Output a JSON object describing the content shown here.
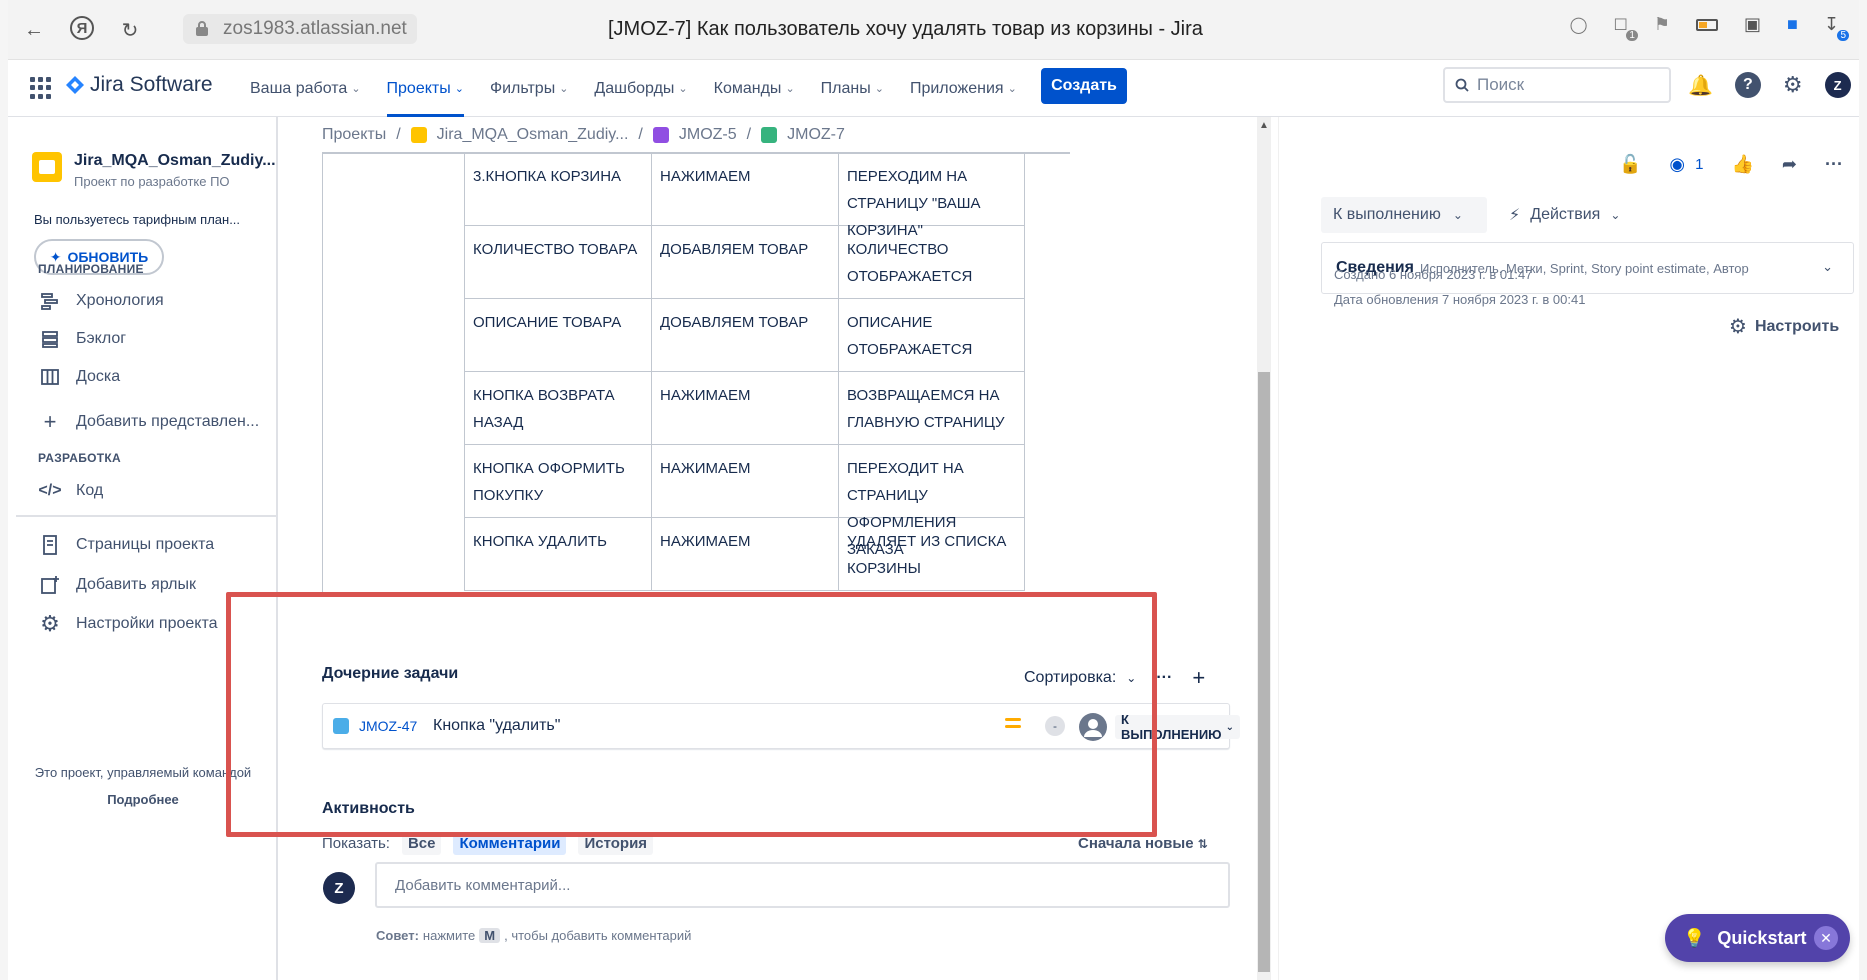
{
  "browser": {
    "url": "zos1983.atlassian.net",
    "title": "[JMOZ-7] Как пользователь хочу удалять товар из корзины - Jira",
    "badges": [
      "1",
      "5"
    ]
  },
  "topnav": {
    "product": "Jira Software",
    "items": [
      {
        "label": "Ваша работа"
      },
      {
        "label": "Проекты"
      },
      {
        "label": "Фильтры"
      },
      {
        "label": "Дашборды"
      },
      {
        "label": "Команды"
      },
      {
        "label": "Планы"
      },
      {
        "label": "Приложения"
      }
    ],
    "create_label": "Создать",
    "search_placeholder": "Поиск",
    "user_initial": "Z"
  },
  "sidebar": {
    "project_name": "Jira_MQA_Osman_Zudiy...",
    "project_type": "Проект по разработке ПО",
    "plan_note": "Вы пользуетесь тарифным план...",
    "upgrade_label": "ОБНОВИТЬ",
    "planning_label": "ПЛАНИРОВАНИЕ",
    "planning_items": [
      "Хронология",
      "Бэклог",
      "Доска"
    ],
    "add_view": "Добавить представлен...",
    "dev_label": "РАЗРАБОТКА",
    "dev_items": [
      "Код"
    ],
    "bottom_items": [
      "Страницы проекта",
      "Добавить ярлык",
      "Настройки проекта"
    ],
    "footer_text": "Это проект, управляемый командой",
    "footer_link": "Подробнее"
  },
  "breadcrumb": [
    "Проекты",
    "Jira_MQA_Osman_Zudiy...",
    "JMOZ-5",
    "JMOZ-7"
  ],
  "table_rows": [
    [
      "3.КНОПКА КОРЗИНА",
      "НАЖИМАЕМ",
      "ПЕРЕХОДИМ НА СТРАНИЦУ \"ВАША КОРЗИНА\""
    ],
    [
      "КОЛИЧЕСТВО ТОВАРА",
      "ДОБАВЛЯЕМ ТОВАР",
      "КОЛИЧЕСТВО ОТОБРАЖАЕТСЯ"
    ],
    [
      "ОПИСАНИЕ ТОВАРА",
      "ДОБАВЛЯЕМ ТОВАР",
      "ОПИСАНИЕ ОТОБРАЖАЕТСЯ"
    ],
    [
      "КНОПКА ВОЗВРАТА НАЗАД",
      "НАЖИМАЕМ",
      "ВОЗВРАЩАЕМСЯ НА ГЛАВНУЮ СТРАНИЦУ"
    ],
    [
      "КНОПКА ОФОРМИТЬ ПОКУПКУ",
      "НАЖИМАЕМ",
      "ПЕРЕХОДИТ НА СТРАНИЦУ ОФОРМЛЕНИЯ ЗАКАЗА"
    ],
    [
      "КНОПКА УДАЛИТЬ",
      "НАЖИМАЕМ",
      "УДАЛЯЕТ ИЗ СПИСКА КОРЗИНЫ"
    ]
  ],
  "subtasks": {
    "title": "Дочерние задачи",
    "sort_label": "Сортировка:",
    "items": [
      {
        "key": "JMOZ-47",
        "summary": "Кнопка \"удалить\"",
        "estimate": "-",
        "status": "К ВЫПОЛНЕНИЮ"
      }
    ]
  },
  "activity": {
    "title": "Активность",
    "show_label": "Показать:",
    "filters": [
      "Все",
      "Комментарии",
      "История"
    ],
    "order_label": "Сначала новые",
    "comment_placeholder": "Добавить комментарий...",
    "avatar_initial": "Z",
    "tip_prefix": "Совет:",
    "tip_mid": "нажмите",
    "tip_key": "M",
    "tip_suffix": ", чтобы добавить комментарий"
  },
  "right_panel": {
    "watchers": "1",
    "status_label": "К выполнению",
    "actions_label": "Действия",
    "details_title": "Сведения",
    "details_fields": "Исполнитель, Метки, Sprint, Story point estimate, Автор",
    "created": "Создано 6 ноября 2023 г. в 01:47",
    "updated": "Дата обновления 7 ноября 2023 г. в 00:41",
    "configure_label": "Настроить"
  },
  "quickstart_label": "Quickstart",
  "colors": {
    "accent": "#0052cc",
    "highlight": "#d9534f",
    "quickstart": "#5243aa"
  }
}
